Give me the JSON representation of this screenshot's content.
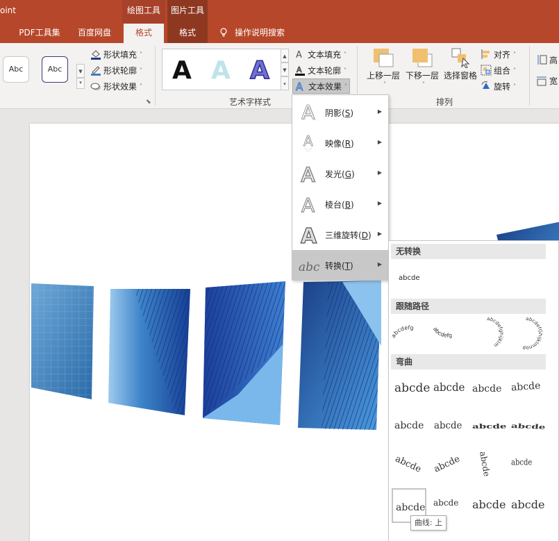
{
  "window": {
    "app_name": "oint"
  },
  "context_tabs": {
    "drawing_tools": "绘图工具",
    "picture_tools": "图片工具"
  },
  "tabs": {
    "pdf": "PDF工具集",
    "baidu": "百度网盘",
    "format1": "格式",
    "format2": "格式",
    "search": "操作说明搜索"
  },
  "shape_styles": {
    "abc1": "Abc",
    "abc2": "Abc",
    "fill": "形状填充",
    "outline": "形状轮廓",
    "effect": "形状效果"
  },
  "wordart": {
    "label": "艺术字样式",
    "letters": [
      "A",
      "A",
      "A"
    ],
    "text_fill": "文本填充",
    "text_outline": "文本轮廓",
    "text_effect": "文本效果"
  },
  "arrange": {
    "label": "排列",
    "bring_forward": "上移一层",
    "send_backward": "下移一层",
    "selection_pane": "选择窗格",
    "align": "对齐",
    "group": "组合",
    "rotate": "旋转",
    "height": "高",
    "width": "宽"
  },
  "text_effect_menu": [
    {
      "label": "阴影",
      "key": "S",
      "icon": "shadow-icon"
    },
    {
      "label": "映像",
      "key": "R",
      "icon": "reflection-icon"
    },
    {
      "label": "发光",
      "key": "G",
      "icon": "glow-icon"
    },
    {
      "label": "棱台",
      "key": "B",
      "icon": "bevel-icon"
    },
    {
      "label": "三维旋转",
      "key": "D",
      "icon": "3d-rotation-icon"
    },
    {
      "label": "转换",
      "key": "T",
      "icon": "transform-icon"
    }
  ],
  "transform_submenu": {
    "no_transform": "无转换",
    "no_transform_sample": "abcde",
    "follow_path": "跟随路径",
    "warp": "弯曲",
    "path_samples": [
      "abcdefg",
      "abcdefg",
      "abcdefghijklm",
      "abcdefGhijklmnop"
    ],
    "warp_sample": "abcde",
    "tooltip": "曲线: 上"
  },
  "colors": {
    "title_bar": "#b7472a",
    "picture_tools": "#8e3822",
    "photo_blue": "#1f5fb0"
  }
}
